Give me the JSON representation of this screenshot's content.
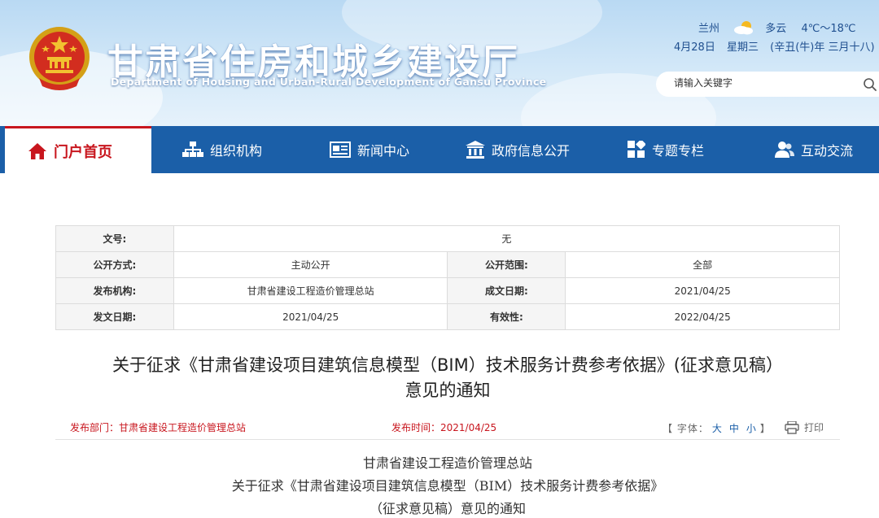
{
  "header": {
    "site_title": "甘肃省住房和城乡建设厅",
    "site_subtitle": "Department of Housing and Urban-Rural Development of Gansu Province",
    "weather": {
      "city": "兰州",
      "icon": "partly-cloudy-icon",
      "condition": "多云",
      "temperature": "4℃～18℃",
      "date": "4月28日",
      "weekday": "星期三",
      "lunar": "(辛丑(牛)年 三月十八)"
    },
    "search": {
      "placeholder": "请输入关键字"
    }
  },
  "nav": {
    "items": [
      {
        "label": "门户首页",
        "icon": "home-icon"
      },
      {
        "label": "组织机构",
        "icon": "org-chart-icon"
      },
      {
        "label": "新闻中心",
        "icon": "news-icon"
      },
      {
        "label": "政府信息公开",
        "icon": "government-icon"
      },
      {
        "label": "专题专栏",
        "icon": "grid-icon"
      },
      {
        "label": "互动交流",
        "icon": "users-icon"
      }
    ]
  },
  "meta": {
    "doc_no_label": "文号:",
    "doc_no": "无",
    "publicity_label": "公开方式:",
    "publicity": "主动公开",
    "scope_label": "公开范围:",
    "scope": "全部",
    "issuer_label": "发布机构:",
    "issuer": "甘肃省建设工程造价管理总站",
    "created_label": "成文日期:",
    "created": "2021/04/25",
    "issued_label": "发文日期:",
    "issued": "2021/04/25",
    "valid_label": "有效性:",
    "valid": "2022/04/25"
  },
  "article": {
    "title_line1": "关于征求《甘肃省建设项目建筑信息模型（BIM）技术服务计费参考依据》(征求意见稿）",
    "title_line2": "意见的通知",
    "dept": "发布部门：甘肃省建设工程造价管理总站",
    "time": "发布时间：2021/04/25",
    "font_label_open": "【 字体：",
    "font_large": "大",
    "font_medium": "中",
    "font_small": "小",
    "font_label_close": "】",
    "print_label": "打印",
    "body_line1": "甘肃省建设工程造价管理总站",
    "body_line2": "关于征求《甘肃省建设项目建筑信息模型（BIM）技术服务计费参考依据》",
    "body_line3": "（征求意见稿）意见的通知"
  },
  "colors": {
    "nav_bg": "#1b5fa8",
    "accent_red": "#c8161e"
  }
}
